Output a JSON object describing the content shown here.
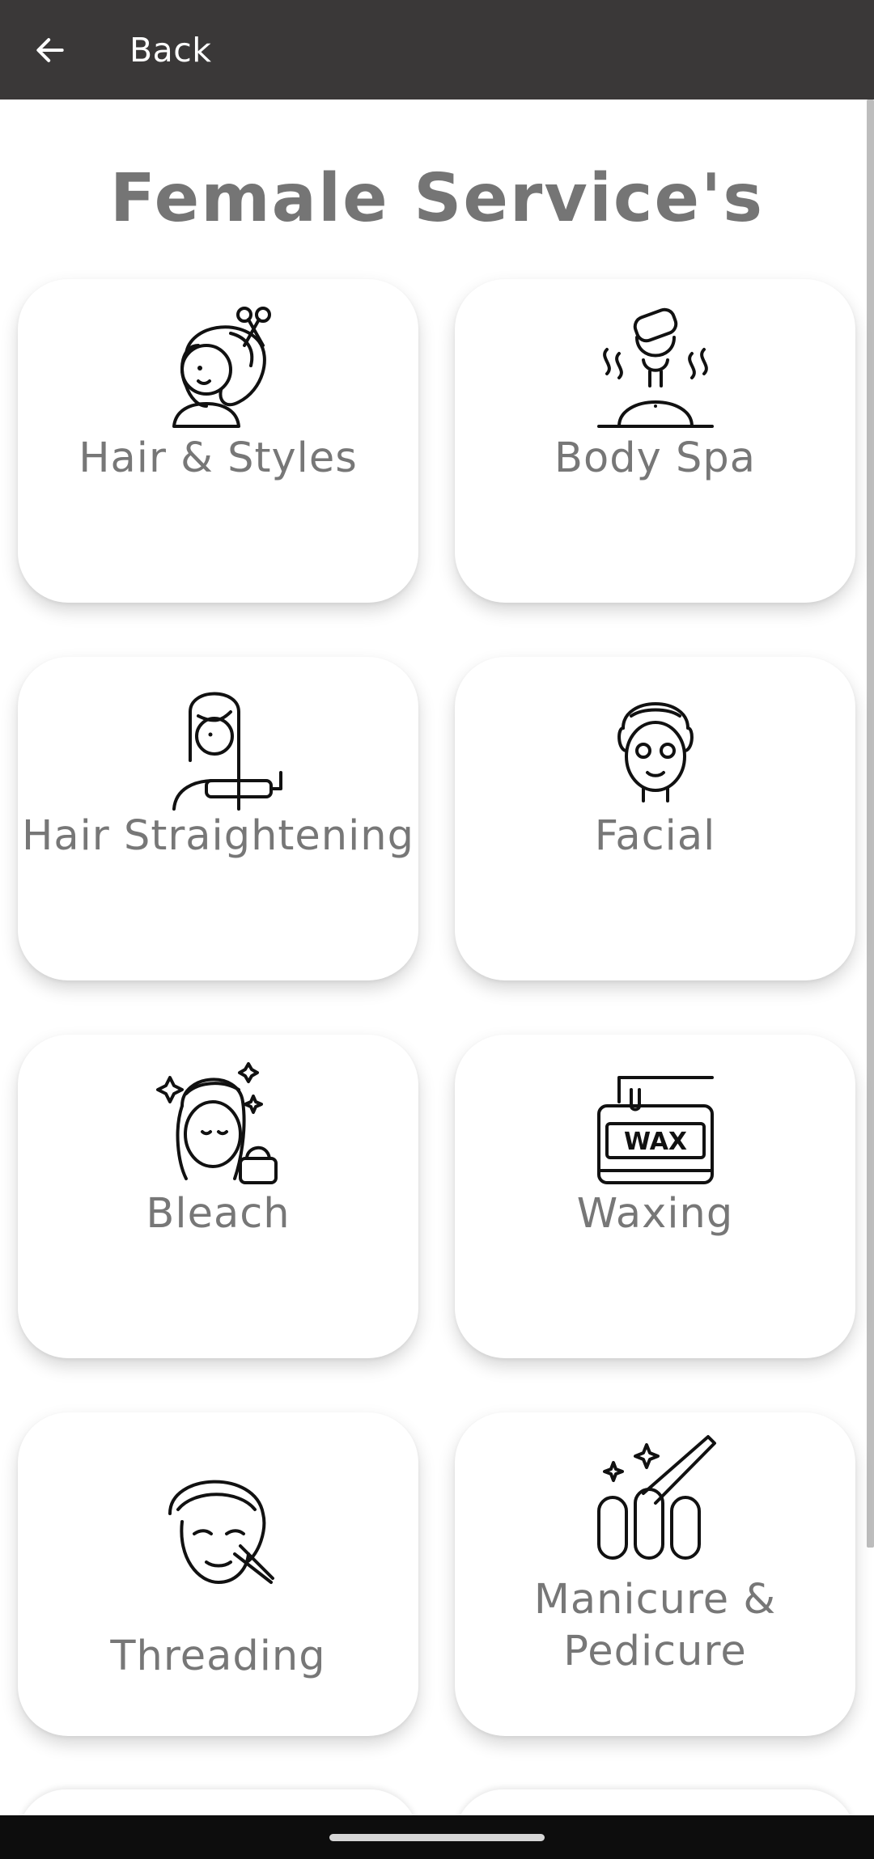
{
  "header": {
    "back_label": "Back"
  },
  "page": {
    "title": "Female Service's"
  },
  "services": [
    {
      "label": "Hair & Styles",
      "icon": "hair-styles-icon"
    },
    {
      "label": "Body Spa",
      "icon": "body-spa-icon"
    },
    {
      "label": "Hair Straightening",
      "icon": "hair-straightening-icon"
    },
    {
      "label": "Facial",
      "icon": "facial-icon"
    },
    {
      "label": "Bleach",
      "icon": "bleach-icon"
    },
    {
      "label": "Waxing",
      "icon": "waxing-icon",
      "icon_text": "WAX"
    },
    {
      "label": "Threading",
      "icon": "threading-icon"
    },
    {
      "label": "Manicure &",
      "label_line2": "Pedicure",
      "icon": "manicure-pedicure-icon"
    }
  ]
}
